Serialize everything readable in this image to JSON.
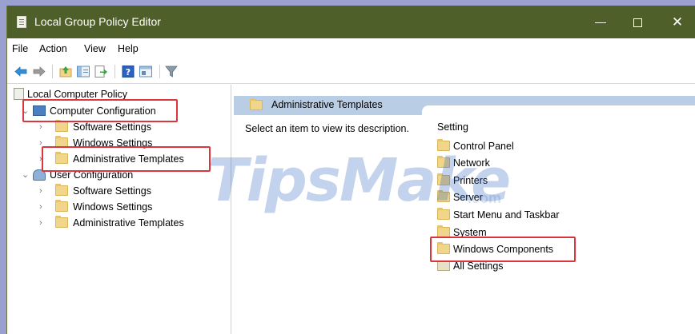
{
  "window": {
    "title": "Local Group Policy Editor"
  },
  "menu": [
    "File",
    "Action",
    "View",
    "Help"
  ],
  "toolbar_icons": [
    "back-arrow-icon",
    "forward-arrow-icon",
    "up-folder-icon",
    "show-hide-tree-icon",
    "export-list-icon",
    "help-icon",
    "properties-icon",
    "filter-icon"
  ],
  "tree": {
    "root": "Local Computer Policy",
    "computer": {
      "label": "Computer Configuration",
      "children": [
        "Software Settings",
        "Windows Settings",
        "Administrative Templates"
      ]
    },
    "user": {
      "label": "User Configuration",
      "children": [
        "Software Settings",
        "Windows Settings",
        "Administrative Templates"
      ]
    }
  },
  "right": {
    "header": "Administrative Templates",
    "description": "Select an item to view its description.",
    "column": "Setting",
    "items": [
      "Control Panel",
      "Network",
      "Printers",
      "Server",
      "Start Menu and Taskbar",
      "System",
      "Windows Components",
      "All Settings"
    ]
  },
  "watermark": {
    "text": "TipsMake",
    "sub": ".com"
  },
  "colors": {
    "titlebar": "#4f5f2a",
    "header": "#b9cde4",
    "highlight": "#d9363e",
    "folder": "#f1d58a"
  }
}
